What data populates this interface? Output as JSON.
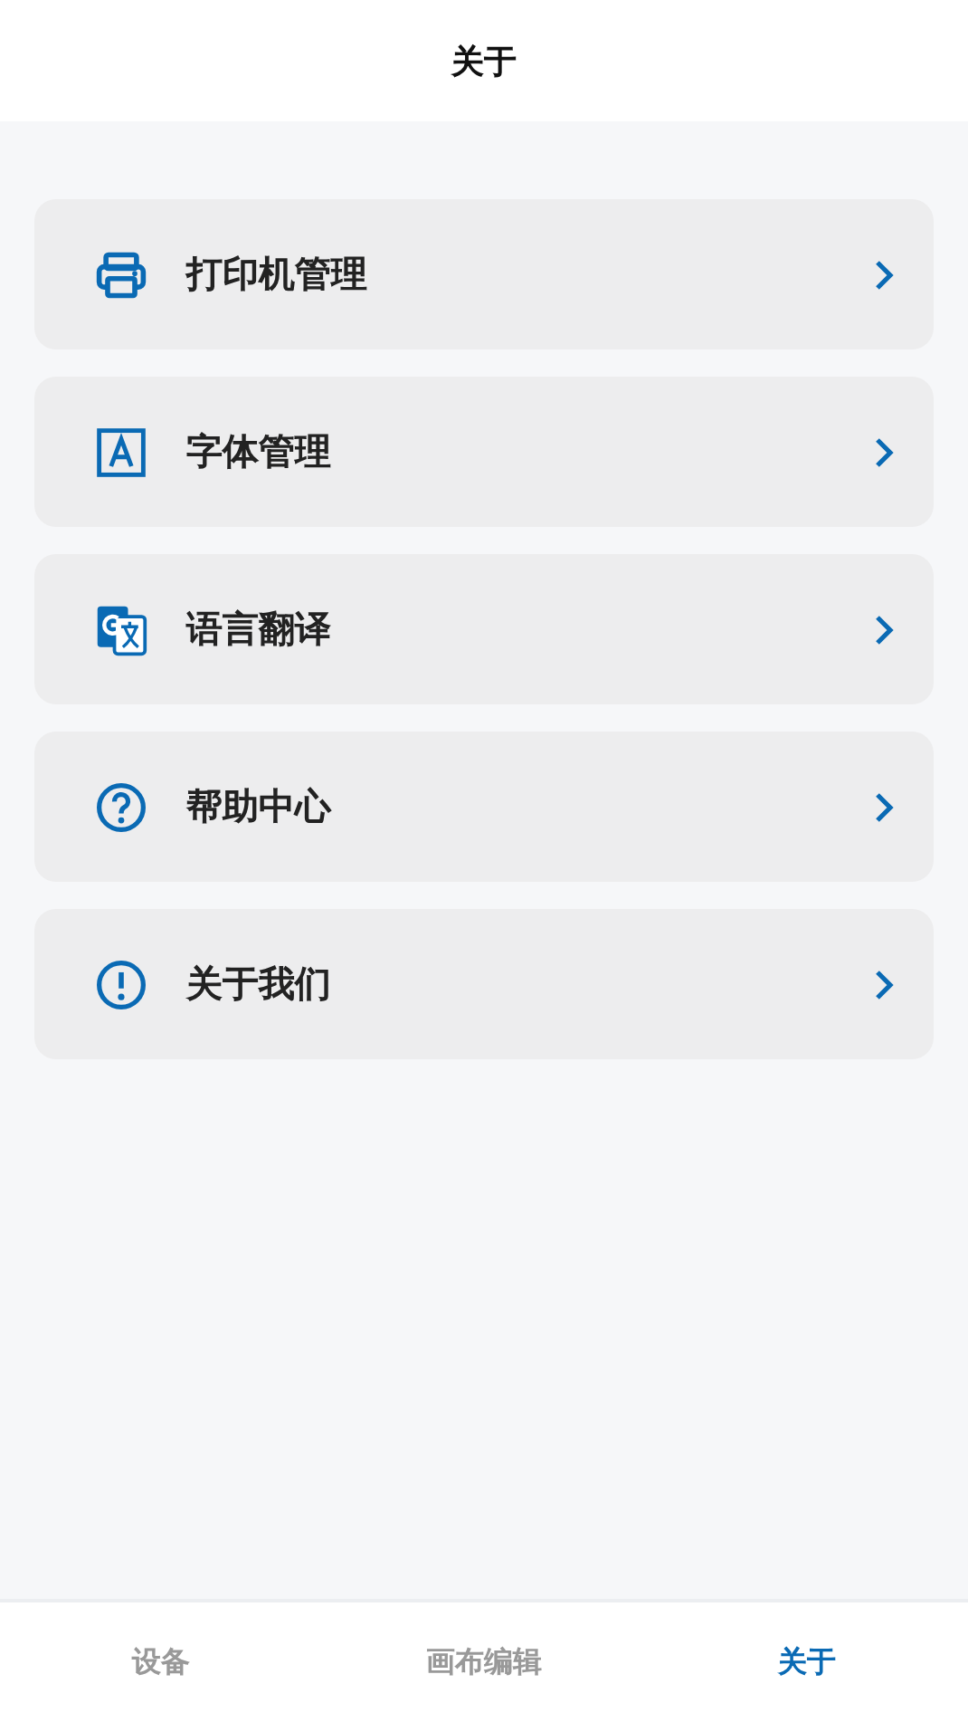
{
  "header": {
    "title": "关于"
  },
  "menu": [
    {
      "kind": "printer",
      "label": "打印机管理"
    },
    {
      "kind": "font",
      "label": "字体管理"
    },
    {
      "kind": "translate",
      "label": "语言翻译"
    },
    {
      "kind": "help",
      "label": "帮助中心"
    },
    {
      "kind": "info",
      "label": "关于我们"
    }
  ],
  "tabs": [
    {
      "label": "设备",
      "selected": false
    },
    {
      "label": "画布编辑",
      "selected": false
    },
    {
      "label": "关于",
      "selected": true
    }
  ]
}
